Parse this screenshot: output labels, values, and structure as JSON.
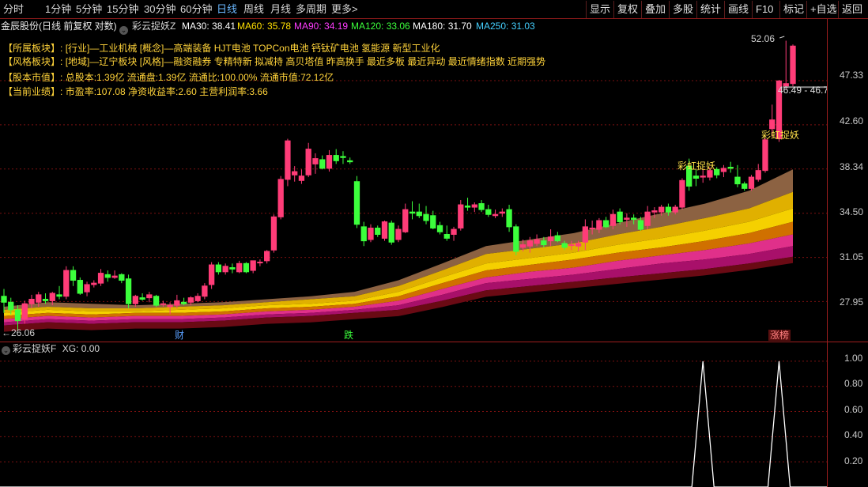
{
  "toolbar": {
    "periods": [
      "分时",
      "1分钟",
      "5分钟",
      "15分钟",
      "30分钟",
      "60分钟",
      "日线",
      "周线",
      "月线",
      "多周期",
      "更多"
    ],
    "active_period": "日线",
    "more_arrow": ">",
    "right_buttons": [
      "显示",
      "复权",
      "叠加",
      "多股",
      "统计",
      "画线",
      "F10",
      "标记",
      "+自选",
      "返回"
    ]
  },
  "header": {
    "stock": "金辰股份(日线 前复权 对数)",
    "indicator": "彩云捉妖Z",
    "ma": [
      {
        "label": "MA30: 38.41",
        "color": "#ffffff"
      },
      {
        "label": "MA60: 35.78",
        "color": "#ffe000"
      },
      {
        "label": "MA90: 34.19",
        "color": "#ff3cff"
      },
      {
        "label": "MA120: 33.06",
        "color": "#3cff3c"
      },
      {
        "label": "MA180: 31.70",
        "color": "#ffffff"
      },
      {
        "label": "MA250: 31.03",
        "color": "#44d0ff"
      }
    ]
  },
  "info": [
    {
      "key": "【所属板块】:",
      "value": "[行业]—工业机械 [概念]—高端装备 HJT电池 TOPCon电池 钙钛矿电池 氢能源 新型工业化"
    },
    {
      "key": "【风格板块】:",
      "value": "[地域]—辽宁板块 [风格]—融资融券 专精特新 拟减持 高贝塔值 昨高换手 最近多板 最近异动 最近情绪指数 近期强势"
    },
    {
      "key": "【股本市值】:",
      "value": "总股本:1.39亿 流通盘:1.39亿 流通比:100.00% 流通市值:72.12亿"
    },
    {
      "key": "【当前业绩】:",
      "value": "市盈率:107.08 净资收益率:2.60 主营利润率:3.66"
    }
  ],
  "price_axis": [
    "47.33",
    "42.60",
    "38.34",
    "34.50",
    "31.05",
    "27.95"
  ],
  "annotations": {
    "high": "52.06",
    "low": "26.06",
    "price_box": "46.49 - 46.7",
    "signal_text": "彩虹捉妖",
    "events": [
      {
        "text": "财",
        "color": "#5aa0ff"
      },
      {
        "text": "跌",
        "color": "#3cff3c"
      },
      {
        "text": "涨榜",
        "color": "#ff8080"
      }
    ]
  },
  "sub_indicator": {
    "name": "彩云捉妖F",
    "xg_label": "XG: 0.00",
    "axis": [
      "1.00",
      "0.80",
      "0.60",
      "0.40",
      "0.20"
    ]
  },
  "colors": {
    "up": "#ff3c78",
    "down": "#3cff3c",
    "grid": "#7a1010",
    "band_brown": "#8c6242",
    "band_gold": "#e0b000",
    "band_yellow": "#f5d000",
    "band_orange": "#d07000",
    "band_pink": "#e0308a",
    "band_magenta": "#a8106a",
    "band_dark": "#6a0a14"
  },
  "chart_data": {
    "type": "candlestick",
    "scale": "log",
    "ylim": [
      25.5,
      52.8
    ],
    "grid": true,
    "candles": [
      [
        28.3,
        28.8,
        27.2,
        27.9
      ],
      [
        27.9,
        28.2,
        27.1,
        27.4
      ],
      [
        27.4,
        27.7,
        26.06,
        26.7
      ],
      [
        26.8,
        28.0,
        26.5,
        27.8
      ],
      [
        27.8,
        28.4,
        27.5,
        28.1
      ],
      [
        27.9,
        28.6,
        27.6,
        28.4
      ],
      [
        28.1,
        28.5,
        27.8,
        28.0
      ],
      [
        28.0,
        28.6,
        27.7,
        28.5
      ],
      [
        28.4,
        29.0,
        28.1,
        28.3
      ],
      [
        28.3,
        30.4,
        28.1,
        30.1
      ],
      [
        30.1,
        30.4,
        29.0,
        29.4
      ],
      [
        29.4,
        29.6,
        28.4,
        28.5
      ],
      [
        28.6,
        29.3,
        28.3,
        29.1
      ],
      [
        29.1,
        29.4,
        28.9,
        29.2
      ],
      [
        29.2,
        30.2,
        29.0,
        29.9
      ],
      [
        29.8,
        30.1,
        29.3,
        29.6
      ],
      [
        29.6,
        30.1,
        29.5,
        29.7
      ],
      [
        29.8,
        29.9,
        29.2,
        29.4
      ],
      [
        29.5,
        29.8,
        27.5,
        27.8
      ],
      [
        27.8,
        28.4,
        27.6,
        28.3
      ],
      [
        28.2,
        28.5,
        28.0,
        28.1
      ],
      [
        28.2,
        28.6,
        27.9,
        28.4
      ],
      [
        28.3,
        28.4,
        27.6,
        27.7
      ],
      [
        27.8,
        28.0,
        27.6,
        27.8
      ],
      [
        27.6,
        27.9,
        27.1,
        27.7
      ],
      [
        27.7,
        28.4,
        27.5,
        28.0
      ],
      [
        27.9,
        28.2,
        27.7,
        27.8
      ],
      [
        27.9,
        28.3,
        27.7,
        28.2
      ],
      [
        28.0,
        28.5,
        27.9,
        28.3
      ],
      [
        28.3,
        29.2,
        28.1,
        29.0
      ],
      [
        29.1,
        30.7,
        28.8,
        30.5
      ],
      [
        30.5,
        30.7,
        29.8,
        30.0
      ],
      [
        30.0,
        30.6,
        29.8,
        30.4
      ],
      [
        30.3,
        30.6,
        29.9,
        30.2
      ],
      [
        30.0,
        30.8,
        29.9,
        30.6
      ],
      [
        30.6,
        30.7,
        29.9,
        30.0
      ],
      [
        30.1,
        30.8,
        29.9,
        30.8
      ],
      [
        30.7,
        30.9,
        30.4,
        30.7
      ],
      [
        30.8,
        31.6,
        30.6,
        31.5
      ],
      [
        31.6,
        34.4,
        31.4,
        34.2
      ],
      [
        34.2,
        37.7,
        34.0,
        37.4
      ],
      [
        37.4,
        41.2,
        36.8,
        41.0
      ],
      [
        37.8,
        38.6,
        37.2,
        38.1
      ],
      [
        37.3,
        38.3,
        37.0,
        37.7
      ],
      [
        37.8,
        40.8,
        37.6,
        40.2
      ],
      [
        38.8,
        39.8,
        37.9,
        39.3
      ],
      [
        39.2,
        39.6,
        38.3,
        38.4
      ],
      [
        38.4,
        40.1,
        38.1,
        39.6
      ],
      [
        39.6,
        40.2,
        38.8,
        39.1
      ],
      [
        39.5,
        40.0,
        38.8,
        39.4
      ],
      [
        39.1,
        39.4,
        38.8,
        39.0
      ],
      [
        37.2,
        37.7,
        33.3,
        33.6
      ],
      [
        33.4,
        33.8,
        31.9,
        32.3
      ],
      [
        32.4,
        33.6,
        32.2,
        33.3
      ],
      [
        33.3,
        33.5,
        32.6,
        32.8
      ],
      [
        32.5,
        33.9,
        32.3,
        33.8
      ],
      [
        33.7,
        33.9,
        32.0,
        32.2
      ],
      [
        32.4,
        33.5,
        32.2,
        33.2
      ],
      [
        33.0,
        35.3,
        32.9,
        34.8
      ],
      [
        34.6,
        35.5,
        34.0,
        34.5
      ],
      [
        34.6,
        35.3,
        34.1,
        34.3
      ],
      [
        34.4,
        35.1,
        33.6,
        33.9
      ],
      [
        34.3,
        34.7,
        33.2,
        33.3
      ],
      [
        33.5,
        33.8,
        32.8,
        33.0
      ],
      [
        32.8,
        33.5,
        32.3,
        32.5
      ],
      [
        32.8,
        33.4,
        32.3,
        33.2
      ],
      [
        33.3,
        35.6,
        33.1,
        35.2
      ],
      [
        35.1,
        35.8,
        34.7,
        35.0
      ],
      [
        35.0,
        35.4,
        34.6,
        35.2
      ],
      [
        35.3,
        35.6,
        34.6,
        34.8
      ],
      [
        34.8,
        35.2,
        34.2,
        34.4
      ],
      [
        34.3,
        34.8,
        34.1,
        34.4
      ],
      [
        34.5,
        34.9,
        34.2,
        34.6
      ],
      [
        34.8,
        35.2,
        33.0,
        33.4
      ],
      [
        33.4,
        33.6,
        31.2,
        31.5
      ],
      [
        31.8,
        32.4,
        31.5,
        32.0
      ],
      [
        31.9,
        32.6,
        31.4,
        32.3
      ],
      [
        32.1,
        32.8,
        31.9,
        32.4
      ],
      [
        32.3,
        32.6,
        31.8,
        32.0
      ],
      [
        32.3,
        33.2,
        31.9,
        32.6
      ],
      [
        32.7,
        33.0,
        32.2,
        32.3
      ],
      [
        32.1,
        32.3,
        31.6,
        31.8
      ],
      [
        32.0,
        32.3,
        31.6,
        32.0
      ],
      [
        31.9,
        32.3,
        31.5,
        32.1
      ],
      [
        32.2,
        34.0,
        31.6,
        33.4
      ],
      [
        33.3,
        33.9,
        32.8,
        33.3
      ],
      [
        33.2,
        34.1,
        32.9,
        33.9
      ],
      [
        33.9,
        34.2,
        33.3,
        33.4
      ],
      [
        33.5,
        34.8,
        33.2,
        34.4
      ],
      [
        34.6,
        34.9,
        33.6,
        33.8
      ],
      [
        34.0,
        34.5,
        33.4,
        34.1
      ],
      [
        34.1,
        34.4,
        33.6,
        34.0
      ],
      [
        33.9,
        34.2,
        33.1,
        33.2
      ],
      [
        33.5,
        35.1,
        33.2,
        34.6
      ],
      [
        34.6,
        35.0,
        34.1,
        34.7
      ],
      [
        34.6,
        35.2,
        34.3,
        35.0
      ],
      [
        35.0,
        35.3,
        34.3,
        34.6
      ],
      [
        34.6,
        35.2,
        34.4,
        35.0
      ],
      [
        35.0,
        37.5,
        34.8,
        37.3
      ],
      [
        38.6,
        39.3,
        36.4,
        36.8
      ],
      [
        37.7,
        38.3,
        36.8,
        37.5
      ],
      [
        37.6,
        38.3,
        37.1,
        37.7
      ],
      [
        37.6,
        38.5,
        37.3,
        38.2
      ],
      [
        38.3,
        38.5,
        37.5,
        37.8
      ],
      [
        38.1,
        38.7,
        37.6,
        38.4
      ],
      [
        38.5,
        39.0,
        38.0,
        38.4
      ],
      [
        37.6,
        38.7,
        36.7,
        37.0
      ],
      [
        37.0,
        37.2,
        36.4,
        36.6
      ],
      [
        36.6,
        37.8,
        36.4,
        37.6
      ],
      [
        37.4,
        38.8,
        37.2,
        38.2
      ],
      [
        38.2,
        41.3,
        38.0,
        41.1
      ],
      [
        42.2,
        44.7,
        41.4,
        43.1
      ],
      [
        41.2,
        47.4,
        40.9,
        47.3
      ],
      [
        46.7,
        52.06,
        46.4,
        47.0
      ],
      [
        47.0,
        51.6,
        46.6,
        51.4
      ]
    ],
    "signal_index": [
      101,
      112
    ],
    "ma_bands": {
      "levels": [
        [
          27.6,
          27.9,
          27.8,
          27.7,
          27.8,
          27.9,
          28.1,
          28.3,
          28.6,
          29.4,
          30.6,
          31.9,
          32.4,
          32.9,
          33.7,
          34.5,
          35.3,
          36.4,
          38.3
        ],
        [
          27.4,
          27.6,
          27.5,
          27.5,
          27.6,
          27.7,
          27.9,
          28.1,
          28.3,
          29.0,
          30.1,
          31.3,
          31.7,
          32.1,
          32.8,
          33.4,
          34.1,
          34.9,
          36.3
        ],
        [
          27.2,
          27.4,
          27.3,
          27.3,
          27.4,
          27.5,
          27.7,
          27.8,
          28.0,
          28.6,
          29.6,
          30.6,
          31.0,
          31.4,
          32.0,
          32.5,
          33.1,
          33.8,
          34.9
        ],
        [
          27.0,
          27.2,
          27.1,
          27.2,
          27.2,
          27.3,
          27.5,
          27.6,
          27.8,
          28.3,
          29.2,
          30.1,
          30.5,
          30.9,
          31.4,
          31.8,
          32.3,
          32.9,
          33.8
        ],
        [
          26.8,
          27.0,
          26.9,
          27.0,
          27.0,
          27.1,
          27.3,
          27.4,
          27.6,
          28.0,
          28.8,
          29.6,
          30.0,
          30.3,
          30.8,
          31.2,
          31.6,
          32.1,
          32.8
        ],
        [
          26.6,
          26.8,
          26.7,
          26.8,
          26.8,
          26.9,
          27.1,
          27.2,
          27.4,
          27.7,
          28.4,
          29.2,
          29.5,
          29.8,
          30.2,
          30.6,
          30.9,
          31.3,
          31.9
        ],
        [
          26.4,
          26.6,
          26.5,
          26.6,
          26.6,
          26.7,
          26.9,
          27.0,
          27.2,
          27.4,
          28.0,
          28.7,
          29.0,
          29.3,
          29.6,
          29.9,
          30.2,
          30.6,
          31.1
        ]
      ]
    },
    "sub_series": {
      "name": "XG",
      "ylim": [
        0,
        1.1
      ],
      "peaks": [
        101,
        112
      ]
    }
  }
}
